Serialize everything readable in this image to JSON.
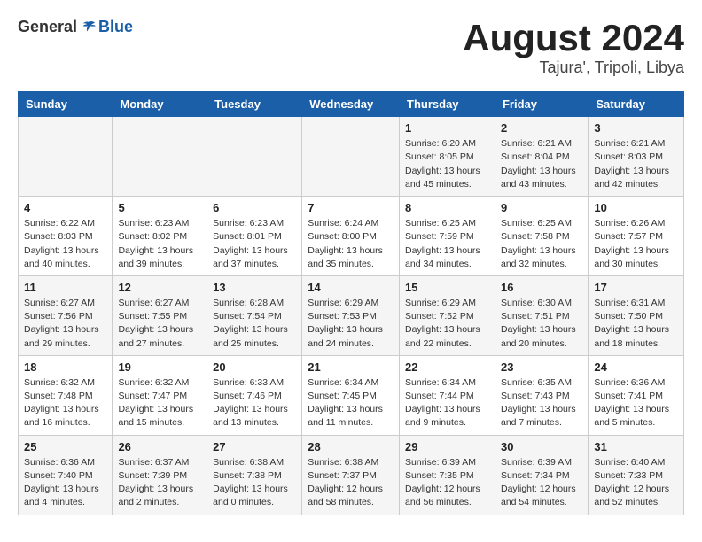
{
  "header": {
    "logo_general": "General",
    "logo_blue": "Blue",
    "month_title": "August 2024",
    "location": "Tajura', Tripoli, Libya"
  },
  "weekdays": [
    "Sunday",
    "Monday",
    "Tuesday",
    "Wednesday",
    "Thursday",
    "Friday",
    "Saturday"
  ],
  "weeks": [
    [
      {
        "day": "",
        "info": ""
      },
      {
        "day": "",
        "info": ""
      },
      {
        "day": "",
        "info": ""
      },
      {
        "day": "",
        "info": ""
      },
      {
        "day": "1",
        "info": "Sunrise: 6:20 AM\nSunset: 8:05 PM\nDaylight: 13 hours\nand 45 minutes."
      },
      {
        "day": "2",
        "info": "Sunrise: 6:21 AM\nSunset: 8:04 PM\nDaylight: 13 hours\nand 43 minutes."
      },
      {
        "day": "3",
        "info": "Sunrise: 6:21 AM\nSunset: 8:03 PM\nDaylight: 13 hours\nand 42 minutes."
      }
    ],
    [
      {
        "day": "4",
        "info": "Sunrise: 6:22 AM\nSunset: 8:03 PM\nDaylight: 13 hours\nand 40 minutes."
      },
      {
        "day": "5",
        "info": "Sunrise: 6:23 AM\nSunset: 8:02 PM\nDaylight: 13 hours\nand 39 minutes."
      },
      {
        "day": "6",
        "info": "Sunrise: 6:23 AM\nSunset: 8:01 PM\nDaylight: 13 hours\nand 37 minutes."
      },
      {
        "day": "7",
        "info": "Sunrise: 6:24 AM\nSunset: 8:00 PM\nDaylight: 13 hours\nand 35 minutes."
      },
      {
        "day": "8",
        "info": "Sunrise: 6:25 AM\nSunset: 7:59 PM\nDaylight: 13 hours\nand 34 minutes."
      },
      {
        "day": "9",
        "info": "Sunrise: 6:25 AM\nSunset: 7:58 PM\nDaylight: 13 hours\nand 32 minutes."
      },
      {
        "day": "10",
        "info": "Sunrise: 6:26 AM\nSunset: 7:57 PM\nDaylight: 13 hours\nand 30 minutes."
      }
    ],
    [
      {
        "day": "11",
        "info": "Sunrise: 6:27 AM\nSunset: 7:56 PM\nDaylight: 13 hours\nand 29 minutes."
      },
      {
        "day": "12",
        "info": "Sunrise: 6:27 AM\nSunset: 7:55 PM\nDaylight: 13 hours\nand 27 minutes."
      },
      {
        "day": "13",
        "info": "Sunrise: 6:28 AM\nSunset: 7:54 PM\nDaylight: 13 hours\nand 25 minutes."
      },
      {
        "day": "14",
        "info": "Sunrise: 6:29 AM\nSunset: 7:53 PM\nDaylight: 13 hours\nand 24 minutes."
      },
      {
        "day": "15",
        "info": "Sunrise: 6:29 AM\nSunset: 7:52 PM\nDaylight: 13 hours\nand 22 minutes."
      },
      {
        "day": "16",
        "info": "Sunrise: 6:30 AM\nSunset: 7:51 PM\nDaylight: 13 hours\nand 20 minutes."
      },
      {
        "day": "17",
        "info": "Sunrise: 6:31 AM\nSunset: 7:50 PM\nDaylight: 13 hours\nand 18 minutes."
      }
    ],
    [
      {
        "day": "18",
        "info": "Sunrise: 6:32 AM\nSunset: 7:48 PM\nDaylight: 13 hours\nand 16 minutes."
      },
      {
        "day": "19",
        "info": "Sunrise: 6:32 AM\nSunset: 7:47 PM\nDaylight: 13 hours\nand 15 minutes."
      },
      {
        "day": "20",
        "info": "Sunrise: 6:33 AM\nSunset: 7:46 PM\nDaylight: 13 hours\nand 13 minutes."
      },
      {
        "day": "21",
        "info": "Sunrise: 6:34 AM\nSunset: 7:45 PM\nDaylight: 13 hours\nand 11 minutes."
      },
      {
        "day": "22",
        "info": "Sunrise: 6:34 AM\nSunset: 7:44 PM\nDaylight: 13 hours\nand 9 minutes."
      },
      {
        "day": "23",
        "info": "Sunrise: 6:35 AM\nSunset: 7:43 PM\nDaylight: 13 hours\nand 7 minutes."
      },
      {
        "day": "24",
        "info": "Sunrise: 6:36 AM\nSunset: 7:41 PM\nDaylight: 13 hours\nand 5 minutes."
      }
    ],
    [
      {
        "day": "25",
        "info": "Sunrise: 6:36 AM\nSunset: 7:40 PM\nDaylight: 13 hours\nand 4 minutes."
      },
      {
        "day": "26",
        "info": "Sunrise: 6:37 AM\nSunset: 7:39 PM\nDaylight: 13 hours\nand 2 minutes."
      },
      {
        "day": "27",
        "info": "Sunrise: 6:38 AM\nSunset: 7:38 PM\nDaylight: 13 hours\nand 0 minutes."
      },
      {
        "day": "28",
        "info": "Sunrise: 6:38 AM\nSunset: 7:37 PM\nDaylight: 12 hours\nand 58 minutes."
      },
      {
        "day": "29",
        "info": "Sunrise: 6:39 AM\nSunset: 7:35 PM\nDaylight: 12 hours\nand 56 minutes."
      },
      {
        "day": "30",
        "info": "Sunrise: 6:39 AM\nSunset: 7:34 PM\nDaylight: 12 hours\nand 54 minutes."
      },
      {
        "day": "31",
        "info": "Sunrise: 6:40 AM\nSunset: 7:33 PM\nDaylight: 12 hours\nand 52 minutes."
      }
    ]
  ]
}
